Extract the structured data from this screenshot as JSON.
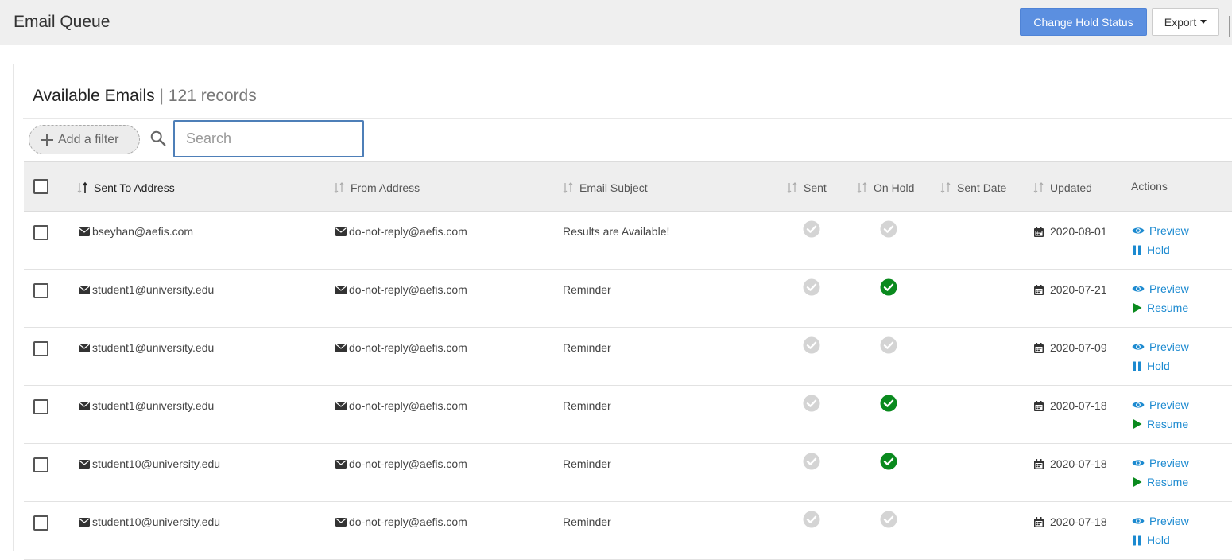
{
  "header": {
    "title": "Email Queue",
    "change_hold_label": "Change Hold Status",
    "export_label": "Export"
  },
  "panel": {
    "title": "Available Emails",
    "separator": "|",
    "record_count": "121 records"
  },
  "filters": {
    "add_filter_label": "Add a filter",
    "search_placeholder": "Search",
    "search_value": ""
  },
  "table": {
    "columns": [
      "Sent To Address",
      "From Address",
      "Email Subject",
      "Sent",
      "On Hold",
      "Sent Date",
      "Updated",
      "Actions"
    ],
    "rows": [
      {
        "to": "bseyhan@aefis.com",
        "from": "do-not-reply@aefis.com",
        "subject": "Results are Available!",
        "sent": false,
        "on_hold": false,
        "sent_date": "",
        "updated": "2020-08-01",
        "action_primary": "Preview",
        "action_secondary": "Hold"
      },
      {
        "to": "student1@university.edu",
        "from": "do-not-reply@aefis.com",
        "subject": "Reminder",
        "sent": false,
        "on_hold": true,
        "sent_date": "",
        "updated": "2020-07-21",
        "action_primary": "Preview",
        "action_secondary": "Resume"
      },
      {
        "to": "student1@university.edu",
        "from": "do-not-reply@aefis.com",
        "subject": "Reminder",
        "sent": false,
        "on_hold": false,
        "sent_date": "",
        "updated": "2020-07-09",
        "action_primary": "Preview",
        "action_secondary": "Hold"
      },
      {
        "to": "student1@university.edu",
        "from": "do-not-reply@aefis.com",
        "subject": "Reminder",
        "sent": false,
        "on_hold": true,
        "sent_date": "",
        "updated": "2020-07-18",
        "action_primary": "Preview",
        "action_secondary": "Resume"
      },
      {
        "to": "student10@university.edu",
        "from": "do-not-reply@aefis.com",
        "subject": "Reminder",
        "sent": false,
        "on_hold": true,
        "sent_date": "",
        "updated": "2020-07-18",
        "action_primary": "Preview",
        "action_secondary": "Resume"
      },
      {
        "to": "student10@university.edu",
        "from": "do-not-reply@aefis.com",
        "subject": "Reminder",
        "sent": false,
        "on_hold": false,
        "sent_date": "",
        "updated": "2020-07-18",
        "action_primary": "Preview",
        "action_secondary": "Hold"
      }
    ]
  },
  "colors": {
    "primary_button": "#5b8fe0",
    "link": "#1c8ad0",
    "status_on": "#0a8a1e",
    "status_off": "#d4d4d4",
    "focus_border": "#4e7fb8"
  },
  "icons": {
    "address": "envelope-icon",
    "date": "calendar-icon",
    "preview": "eye-icon",
    "hold": "pause-icon",
    "resume": "play-icon",
    "status": "check-circle-icon",
    "sort": "sort-icon",
    "search": "search-icon"
  }
}
